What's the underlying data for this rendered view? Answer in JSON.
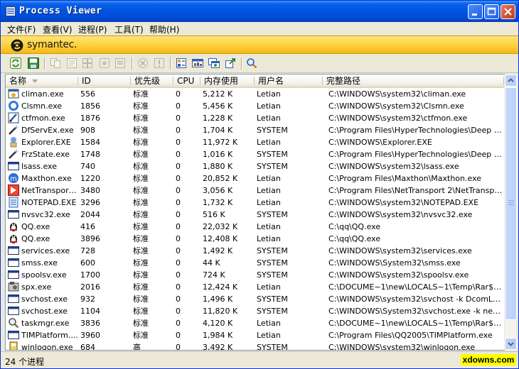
{
  "window": {
    "title": "Process Viewer"
  },
  "menu": [
    "文件(F)",
    "查看(V)",
    "进程(P)",
    "工具(T)",
    "帮助(H)"
  ],
  "banner": {
    "brand": "symantec."
  },
  "toolbar_icons": [
    "refresh-icon",
    "save-icon",
    "copy-icon",
    "properties-icon",
    "modules-icon",
    "threads-icon",
    "details-icon",
    "kill-process-icon",
    "warning-icon",
    "priority-icon",
    "window-list-icon",
    "services-icon",
    "export-icon",
    "find-icon"
  ],
  "table": {
    "columns": [
      "名称",
      "ID",
      "优先级",
      "CPU",
      "内存使用",
      "用户名",
      "完整路径"
    ],
    "rows": [
      {
        "name": "climan.exe",
        "id": "556",
        "priority": "标准",
        "cpu": "0",
        "mem": "5,212 K",
        "user": "Letian",
        "path": "C:\\WINDOWS\\system32\\climan.exe",
        "icon": "app-icon"
      },
      {
        "name": "Clsmn.exe",
        "id": "1856",
        "priority": "标准",
        "cpu": "0",
        "mem": "5,456 K",
        "user": "Letian",
        "path": "C:\\WINDOWS\\system32\\Clsmn.exe",
        "icon": "circle-icon"
      },
      {
        "name": "ctfmon.exe",
        "id": "1876",
        "priority": "标准",
        "cpu": "0",
        "mem": "1,228 K",
        "user": "Letian",
        "path": "C:\\WINDOWS\\system32\\ctfmon.exe",
        "icon": "pen-icon"
      },
      {
        "name": "DfServEx.exe",
        "id": "908",
        "priority": "标准",
        "cpu": "0",
        "mem": "1,704 K",
        "user": "SYSTEM",
        "path": "C:\\Program Files\\HyperTechnologies\\Deep Fre...",
        "icon": "wand-icon"
      },
      {
        "name": "Explorer.EXE",
        "id": "1584",
        "priority": "标准",
        "cpu": "0",
        "mem": "11,972 K",
        "user": "Letian",
        "path": "C:\\WINDOWS\\Explorer.EXE",
        "icon": "explorer-icon"
      },
      {
        "name": "FrzState.exe",
        "id": "1748",
        "priority": "标准",
        "cpu": "0",
        "mem": "1,016 K",
        "user": "SYSTEM",
        "path": "C:\\Program Files\\HyperTechnologies\\Deep Fre...",
        "icon": "wand-icon"
      },
      {
        "name": "lsass.exe",
        "id": "740",
        "priority": "标准",
        "cpu": "0",
        "mem": "1,880 K",
        "user": "SYSTEM",
        "path": "C:\\WINDOWS\\system32\\lsass.exe",
        "icon": "window-icon"
      },
      {
        "name": "Maxthon.exe",
        "id": "1220",
        "priority": "标准",
        "cpu": "0",
        "mem": "20,852 K",
        "user": "Letian",
        "path": "C:\\Program Files\\Maxthon\\Maxthon.exe",
        "icon": "maxthon-icon"
      },
      {
        "name": "NetTransport...",
        "id": "3480",
        "priority": "标准",
        "cpu": "0",
        "mem": "3,056 K",
        "user": "Letian",
        "path": "C:\\Program Files\\NetTransport 2\\NetTransport...",
        "icon": "nettransport-icon"
      },
      {
        "name": "NOTEPAD.EXE",
        "id": "3296",
        "priority": "标准",
        "cpu": "0",
        "mem": "1,732 K",
        "user": "Letian",
        "path": "C:\\WINDOWS\\system32\\NOTEPAD.EXE",
        "icon": "notepad-icon"
      },
      {
        "name": "nvsvc32.exe",
        "id": "2044",
        "priority": "标准",
        "cpu": "0",
        "mem": "516 K",
        "user": "SYSTEM",
        "path": "C:\\WINDOWS\\system32\\nvsvc32.exe",
        "icon": "window-icon"
      },
      {
        "name": "QQ.exe",
        "id": "416",
        "priority": "标准",
        "cpu": "0",
        "mem": "22,032 K",
        "user": "Letian",
        "path": "C:\\qq\\QQ.exe",
        "icon": "qq-penguin-icon"
      },
      {
        "name": "QQ.exe",
        "id": "3896",
        "priority": "标准",
        "cpu": "0",
        "mem": "12,408 K",
        "user": "Letian",
        "path": "C:\\qq\\QQ.exe",
        "icon": "qq-penguin-icon"
      },
      {
        "name": "services.exe",
        "id": "728",
        "priority": "标准",
        "cpu": "0",
        "mem": "1,492 K",
        "user": "SYSTEM",
        "path": "C:\\WINDOWS\\system32\\services.exe",
        "icon": "window-icon"
      },
      {
        "name": "smss.exe",
        "id": "600",
        "priority": "标准",
        "cpu": "0",
        "mem": "44 K",
        "user": "SYSTEM",
        "path": "C:\\WINDOWS\\System32\\smss.exe",
        "icon": "window-icon"
      },
      {
        "name": "spoolsv.exe",
        "id": "1700",
        "priority": "标准",
        "cpu": "0",
        "mem": "724 K",
        "user": "SYSTEM",
        "path": "C:\\WINDOWS\\system32\\spoolsv.exe",
        "icon": "window-icon"
      },
      {
        "name": "spx.exe",
        "id": "2016",
        "priority": "标准",
        "cpu": "0",
        "mem": "12,424 K",
        "user": "Letian",
        "path": "C:\\DOCUME~1\\new\\LOCALS~1\\Temp\\Rar$EX...",
        "icon": "spx-icon"
      },
      {
        "name": "svchost.exe",
        "id": "932",
        "priority": "标准",
        "cpu": "0",
        "mem": "1,496 K",
        "user": "SYSTEM",
        "path": "C:\\WINDOWS\\system32\\svchost -k DcomLaunch",
        "icon": "window-icon"
      },
      {
        "name": "svchost.exe",
        "id": "1104",
        "priority": "标准",
        "cpu": "0",
        "mem": "11,820 K",
        "user": "SYSTEM",
        "path": "C:\\WINDOWS\\System32\\svchost.exe -k netsvcs",
        "icon": "window-icon"
      },
      {
        "name": "taskmgr.exe",
        "id": "3836",
        "priority": "标准",
        "cpu": "0",
        "mem": "4,120 K",
        "user": "Letian",
        "path": "C:\\DOCUME~1\\new\\LOCALS~1\\Temp\\Rar$EX...",
        "icon": "magnifier-icon"
      },
      {
        "name": "TIMPlatform....",
        "id": "3960",
        "priority": "标准",
        "cpu": "0",
        "mem": "1,984 K",
        "user": "Letian",
        "path": "C:\\Program Files\\QQ2005\\TIMPlatform.exe",
        "icon": "window-icon"
      },
      {
        "name": "winlogon.exe",
        "id": "684",
        "priority": "高",
        "cpu": "0",
        "mem": "3,492 K",
        "user": "SYSTEM",
        "path": "C:\\WINDOWS\\system32\\winlogon.exe",
        "icon": "winlogon-icon"
      }
    ]
  },
  "status": {
    "text": "24 个进程"
  },
  "watermark": {
    "text": "xdowns.com"
  }
}
